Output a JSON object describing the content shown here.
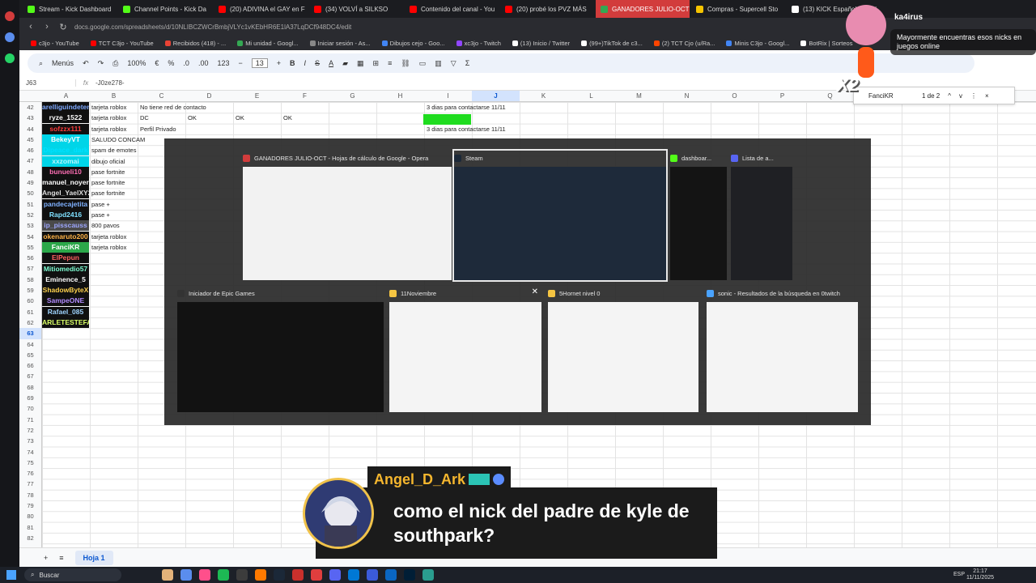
{
  "browser": {
    "tabs": [
      {
        "label": "Stream - Kick Dashboard",
        "color": "#53fc18"
      },
      {
        "label": "Channel Points - Kick Da",
        "color": "#53fc18"
      },
      {
        "label": "(20) ADIVINA el GAY en F",
        "color": "#ff0000"
      },
      {
        "label": "(34) VOLVÍ a SILKSO",
        "color": "#ff0000"
      },
      {
        "label": "Contenido del canal - You",
        "color": "#ff0000"
      },
      {
        "label": "(20) probé los PVZ MÁS",
        "color": "#ff0000"
      },
      {
        "label": "GANADORES JULIO-OCT",
        "color": "#34a853"
      },
      {
        "label": "Compras - Supercell Sto",
        "color": "#f5c400"
      },
      {
        "label": "(13) KICK Español en X: '",
        "color": "#ffffff"
      }
    ],
    "active_tab_index": 6,
    "url": "docs.google.com/spreadsheets/d/10NLIBCZWCrBmbjVLYc1vKEbHR6E1lA37LqDCf948DC4/edit",
    "bookmarks": [
      {
        "label": "c3jo - YouTube",
        "color": "#ff0000"
      },
      {
        "label": "TCT C3jo - YouTube",
        "color": "#ff0000"
      },
      {
        "label": "Recibidos (418) - ...",
        "color": "#ea4335"
      },
      {
        "label": "Mi unidad - Googl...",
        "color": "#34a853"
      },
      {
        "label": "Iniciar sesión - As...",
        "color": "#888888"
      },
      {
        "label": "Dibujos cejo - Goo...",
        "color": "#4285f4"
      },
      {
        "label": "xc3jo - Twitch",
        "color": "#9146ff"
      },
      {
        "label": "(13) Inicio / Twitter",
        "color": "#ffffff"
      },
      {
        "label": "(99+)TikTok de c3...",
        "color": "#ffffff"
      },
      {
        "label": "(2) TCT Cjo (u/Ra...",
        "color": "#ff4500"
      },
      {
        "label": "Minis C3jo - Googl...",
        "color": "#4285f4"
      },
      {
        "label": "BotRix | Sorteos",
        "color": "#ffffff"
      }
    ]
  },
  "sheets": {
    "toolbar": {
      "menus": "Menús",
      "zoom": "100%",
      "currency": "€",
      "percent": "%",
      "decrease_decimals": ".0",
      "increase_decimals": ".00",
      "number_format": "123",
      "font_size": "13",
      "minus": "−",
      "plus": "+",
      "bold": "B",
      "italic": "I",
      "strike": "S",
      "text_color": "A",
      "sum": "Σ"
    },
    "name_box": "J63",
    "fx": "fx",
    "formula": "-J0ze278-",
    "columns": [
      "A",
      "B",
      "C",
      "D",
      "E",
      "F",
      "G",
      "H",
      "I",
      "J",
      "K",
      "L",
      "M",
      "N",
      "O",
      "P",
      "Q"
    ],
    "selected_column": "J",
    "rows": [
      "42",
      "43",
      "44",
      "45",
      "46",
      "47",
      "48",
      "49",
      "50",
      "51",
      "52",
      "53",
      "54",
      "55",
      "56",
      "57",
      "58",
      "59",
      "60",
      "61",
      "62",
      "63",
      "64",
      "65",
      "66",
      "67",
      "68",
      "69",
      "70",
      "71",
      "72",
      "73",
      "74",
      "75",
      "76",
      "77",
      "78",
      "79",
      "80",
      "81",
      "82"
    ],
    "selected_row": "63",
    "names": [
      {
        "text": "arelliguindeten",
        "color": "#7fa9ff"
      },
      {
        "text": "ryze_1522",
        "color": "#ffffff"
      },
      {
        "text": "sofzzx111",
        "color": "#ff3b3b"
      },
      {
        "text": "BekeyVT",
        "color": "#ffffff",
        "bg": "#00d5e8"
      },
      {
        "text": "Dipeace_dark",
        "color": "#00e0ff",
        "bg": "#00d5e8"
      },
      {
        "text": "xxzomai",
        "color": "#b8f5ff",
        "bg": "#00d5e8"
      },
      {
        "text": "bunueli10",
        "color": "#ff6fb5"
      },
      {
        "text": "manuel_noyer",
        "color": "#ffffff"
      },
      {
        "text": "Angel_YaelXY2",
        "color": "#dddddd"
      },
      {
        "text": "pandecajetita",
        "color": "#7fb1ff"
      },
      {
        "text": "Rapd2416",
        "color": "#7fe0ff"
      },
      {
        "text": "ip_pisscauss",
        "color": "#9ea7ff",
        "bg": "#4a4a4a"
      },
      {
        "text": "okenaruto200",
        "color": "#ffb347"
      },
      {
        "text": "FanciKR",
        "color": "#ffffff",
        "bg": "#2ca84a"
      },
      {
        "text": "ElPepun",
        "color": "#ff6060"
      },
      {
        "text": "Mitiomedio57",
        "color": "#7fffd4"
      },
      {
        "text": "Eminence_5",
        "color": "#ffffff"
      },
      {
        "text": "ShadowByteX",
        "color": "#ffd24d"
      },
      {
        "text": "SampeONE",
        "color": "#b38cff"
      },
      {
        "text": "Rafael_085",
        "color": "#9fd4ff"
      },
      {
        "text": "ARLETESTEFANIA",
        "color": "#d9ff66"
      }
    ],
    "col_b": [
      "tarjeta roblox",
      "tarjeta roblox",
      "tarjeta roblox",
      "SALUDO CONCAM",
      "spam de emotes",
      "dibujo oficial",
      "pase fortnite",
      "pase fortnite",
      "pase fortnite",
      "pase +",
      "pase +",
      "800 pavos",
      "tarjeta roblox",
      "tarjeta roblox"
    ],
    "other_cells": [
      {
        "text": "No tiene red de contacto",
        "col": "C",
        "row": 0
      },
      {
        "text": "DC",
        "col": "C",
        "row": 1
      },
      {
        "text": "OK",
        "col": "D",
        "row": 1
      },
      {
        "text": "OK",
        "col": "E",
        "row": 1
      },
      {
        "text": "OK",
        "col": "F",
        "row": 1
      },
      {
        "text": "Perfil Privado",
        "col": "C",
        "row": 2
      },
      {
        "text": "3 dias para contactarse 11/11",
        "col": "I",
        "row": 0
      },
      {
        "text": "3 dias para contactarse 11/11",
        "col": "I",
        "row": 2
      }
    ],
    "find": {
      "query": "FanciKR",
      "count": "1 de 2",
      "up": "^",
      "down": "v",
      "more": "⋮",
      "close": "×"
    },
    "sheet_tab": "Hoja 1",
    "add_sheet": "+",
    "all_sheets": "≡"
  },
  "switcher": {
    "windows": [
      {
        "title": "GANADORES JULIO-OCT - Hojas de cálculo de Google - Opera",
        "color": "#d23c3c",
        "bg": "#f2f2f2"
      },
      {
        "title": "Steam",
        "color": "#1b2838",
        "bg": "#1e2a3a"
      },
      {
        "title": "dashboar...",
        "color": "#53fc18",
        "bg": "#141414"
      },
      {
        "title": "Lista de a...",
        "color": "#5865f2",
        "bg": "#1f2024"
      },
      {
        "title": "Iniciador de Epic Games",
        "color": "#333333",
        "bg": "#121212"
      },
      {
        "title": "11Noviembre",
        "color": "#f5c542",
        "bg": "#f4f4f4"
      },
      {
        "title": "5Hornet nivel 0",
        "color": "#f5c542",
        "bg": "#f4f4f4"
      },
      {
        "title": "sonic - Resultados de la búsqueda en 0twitch",
        "color": "#4aa3ff",
        "bg": "#f4f4f4"
      }
    ],
    "selected_index": 1,
    "close_glyph": "✕"
  },
  "overlay": {
    "alert_user": "ka4irus",
    "alert_text": "Mayormente encuentras esos nicks en juegos online",
    "multiplier": "X2",
    "chat_user": "Angel_D_Ark",
    "chat_message": "como el nick del padre de kyle de southpark?"
  },
  "taskbar": {
    "search": "Buscar",
    "lang": "ESP",
    "time": "21:17",
    "date": "11/11/2025",
    "icons": [
      "#e2b27a",
      "#5a8dee",
      "#ff4f8b",
      "#1db954",
      "#3c3c3c",
      "#ff7a00",
      "#1b2838",
      "#c9302c",
      "#e03e3e",
      "#5865f2",
      "#0078d4",
      "#3b5bdb",
      "#0a66c2",
      "#001e36",
      "#2a9d8f"
    ]
  }
}
